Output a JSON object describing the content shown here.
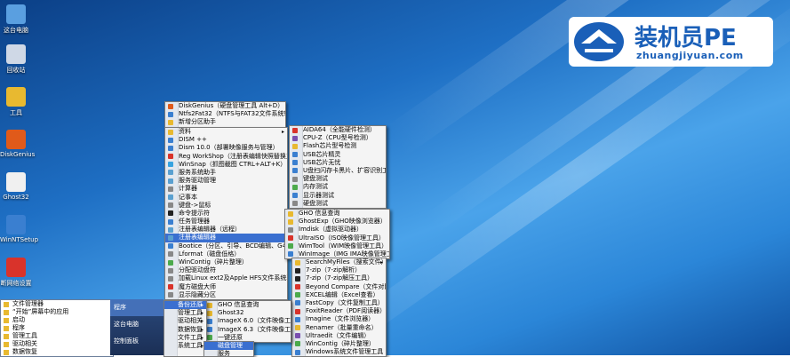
{
  "desktop_icons": [
    {
      "label": "这台电脑",
      "color": "#5a9fe0"
    },
    {
      "label": "回收站",
      "color": "#cfd8e6"
    },
    {
      "label": "工具",
      "color": "#e8b930"
    },
    {
      "label": "DiskGenius",
      "color": "#e05a1a"
    },
    {
      "label": "Ghost32",
      "color": "#f0f0f0"
    },
    {
      "label": "WinNTSetup",
      "color": "#3a7fd0"
    },
    {
      "label": "断网络设置",
      "color": "#d9332b"
    }
  ],
  "logo": {
    "text": "装机员PE",
    "url": "zhuangjiyuan.com"
  },
  "menu_main": {
    "items": [
      {
        "label": "DiskGenius（硬盘管理工具 Alt+D）",
        "icon": "#e05a1a"
      },
      {
        "label": "Ntfs2Fat32（NTFS与FAT32文件系统转换）",
        "icon": "#3a7fd0"
      },
      {
        "label": "新增分区助手",
        "icon": "#e8b930"
      }
    ]
  },
  "menu_tools": {
    "items": [
      {
        "label": "资料",
        "icon": "#e8b930",
        "arrow": "▸"
      },
      {
        "label": "DISM ++",
        "icon": "#3a7fd0"
      },
      {
        "label": "Dism 10.0（部署映像服务与管理）",
        "icon": "#3a7fd0"
      },
      {
        "label": "Reg WorkShop（注册表编辑快照替换工具）",
        "icon": "#d9332b"
      },
      {
        "label": "WinSnap（抓图截图 CTRL+ALT+K）",
        "icon": "#37a3e0"
      },
      {
        "label": "服务系统助手",
        "icon": "#5aa0d0"
      },
      {
        "label": "服务驱动管理",
        "icon": "#5aa0d0"
      },
      {
        "label": "计算器",
        "icon": "#888888"
      },
      {
        "label": "记事本",
        "icon": "#5aa0d0"
      },
      {
        "label": "键盘->鼠标",
        "icon": "#888888"
      },
      {
        "label": "命令提示符",
        "icon": "#222222"
      },
      {
        "label": "任务管理器",
        "icon": "#3a7fd0"
      },
      {
        "label": "注册表编辑器（远程）",
        "icon": "#5aa0d0"
      },
      {
        "label": "注册表编辑器",
        "icon": "#5aa0d0"
      },
      {
        "label": "Bootice（分区、引导、BCD编辑、G4D编辑）",
        "icon": "#3a7fd0"
      },
      {
        "label": "Lformat（磁盘低格）",
        "icon": "#888888"
      },
      {
        "label": "WinContig（碎片整理）",
        "icon": "#4caa4c"
      },
      {
        "label": "分配驱动盘符",
        "icon": "#888888"
      },
      {
        "label": "加载Linux ext2及Apple HFS文件系统驱动",
        "icon": "#888888"
      },
      {
        "label": "魔方磁盘大师",
        "icon": "#d9332b"
      },
      {
        "label": "显示隐藏分区",
        "icon": "#888888"
      }
    ]
  },
  "menu_hardware": {
    "items": [
      {
        "label": "AIDA64（全能硬件检测）",
        "icon": "#d9332b"
      },
      {
        "label": "CPU-Z（CPU型号检测）",
        "icon": "#7a4fb0"
      },
      {
        "label": "Flash芯片型号检测",
        "icon": "#e8b930"
      },
      {
        "label": "USB芯片精灵",
        "icon": "#3a7fd0"
      },
      {
        "label": "USB芯片无忧",
        "icon": "#3a7fd0"
      },
      {
        "label": "U盘扫闪存卡黑片、扩容识别工具",
        "icon": "#3a7fd0"
      },
      {
        "label": "键盘测试",
        "icon": "#888888"
      },
      {
        "label": "内存测试",
        "icon": "#4caa4c"
      },
      {
        "label": "显示器测试",
        "icon": "#3a7fd0"
      },
      {
        "label": "硬盘测试",
        "icon": "#888888"
      }
    ]
  },
  "menu_image": {
    "items": [
      {
        "label": "GHO 信息查询",
        "icon": "#e8b930"
      },
      {
        "label": "GhostExp（GHO映像浏览器）",
        "icon": "#e8b930"
      },
      {
        "label": "Imdisk（虚拟驱动器）",
        "icon": "#888888"
      },
      {
        "label": "UltraISO（ISO映像管理工具）",
        "icon": "#d9332b"
      },
      {
        "label": "WimTool（WIM映像管理工具）",
        "icon": "#4caa4c"
      },
      {
        "label": "WinImage（IMG IMA映像管理工具）",
        "icon": "#3a7fd0"
      }
    ]
  },
  "menu_files": {
    "items": [
      {
        "label": "SearchMyFiles（搜索文件）",
        "icon": "#e8b930",
        "arrow": "▸"
      },
      {
        "label": "7-zip（7-zip解析）",
        "icon": "#222222"
      },
      {
        "label": "7-zip（7-zip解压工具）",
        "icon": "#222222"
      },
      {
        "label": "Beyond Compare（文件对比）",
        "icon": "#d9332b"
      },
      {
        "label": "EXCEL编辑（Excel查看）",
        "icon": "#4caa4c"
      },
      {
        "label": "FastCopy（文件复制工具）",
        "icon": "#3a7fd0"
      },
      {
        "label": "FoxitReader（PDF阅读器）",
        "icon": "#d9332b"
      },
      {
        "label": "Imagine（文件浏览器）",
        "icon": "#3a7fd0"
      },
      {
        "label": "Renamer（批量重命名）",
        "icon": "#e8b930"
      },
      {
        "label": "Ultraedit（文件编辑）",
        "icon": "#7a4fb0"
      },
      {
        "label": "WinContig（碎片整理）",
        "icon": "#4caa4c"
      },
      {
        "label": "Windows系统文件管理工具",
        "icon": "#3a7fd0"
      }
    ]
  },
  "menu_backup": {
    "items": [
      {
        "label": "GHO 信息查询",
        "icon": "#e8b930"
      },
      {
        "label": "Ghost32",
        "icon": "#e8b930"
      },
      {
        "label": "ImageX 6.0（文件映像工具）",
        "icon": "#3a7fd0"
      },
      {
        "label": "ImageX 6.3（文件映像工具）",
        "icon": "#3a7fd0"
      },
      {
        "label": "一键还原",
        "icon": "#4caa4c"
      }
    ]
  },
  "menu_programs": {
    "items": [
      {
        "label": "备份还原",
        "arrow": "▸"
      },
      {
        "label": "管理工具",
        "arrow": "▸"
      },
      {
        "label": "驱动相关",
        "arrow": "▸"
      },
      {
        "label": "数据恢复",
        "arrow": "▸"
      },
      {
        "label": "文件工具",
        "arrow": "▸"
      },
      {
        "label": "系统工具",
        "arrow": "▸"
      }
    ]
  },
  "menu_disk": {
    "items": [
      {
        "label": "磁盘管理"
      },
      {
        "label": "服务"
      }
    ]
  },
  "start_left": {
    "items": [
      {
        "label": "文件管理器"
      },
      {
        "label": "“开始”屏幕中的应用"
      },
      {
        "label": "启动"
      },
      {
        "label": "程序"
      },
      {
        "label": "管理工具"
      },
      {
        "label": "驱动相关"
      },
      {
        "label": "数据恢复"
      }
    ]
  },
  "start_right": {
    "items": [
      {
        "label": "程序"
      },
      {
        "label": "这台电脑"
      },
      {
        "label": "控制面板"
      }
    ]
  }
}
